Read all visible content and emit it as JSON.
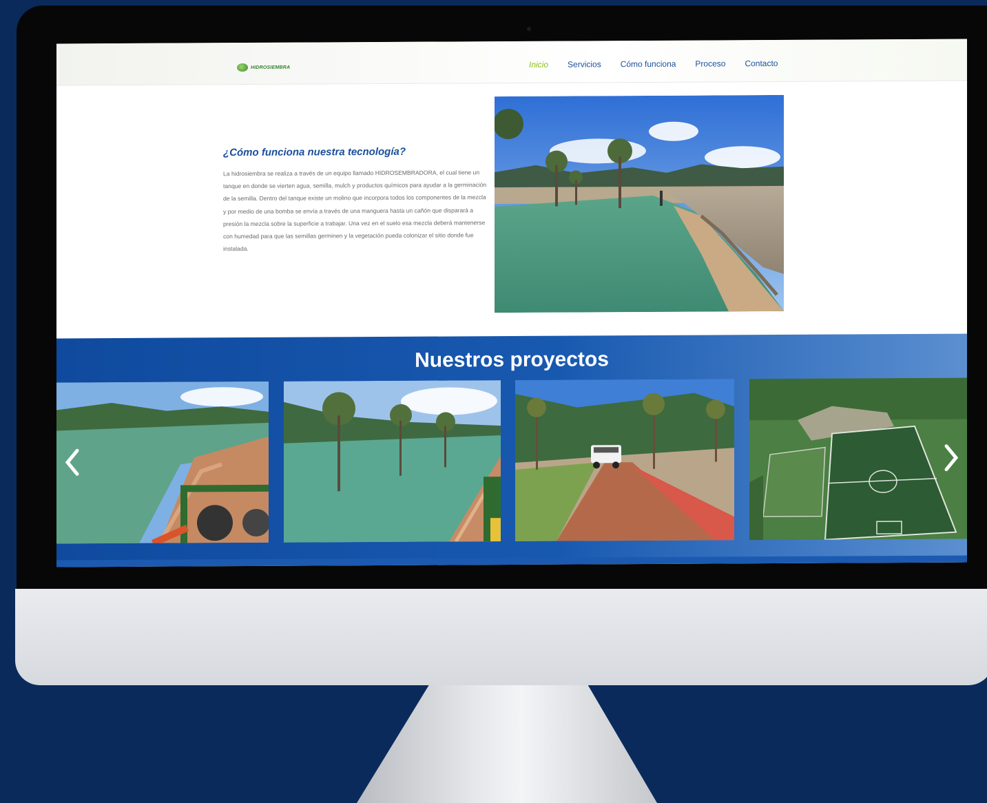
{
  "nav": {
    "logo_text": "HIDROSIEMBRA",
    "items": [
      {
        "label": "Inicio",
        "active": true
      },
      {
        "label": "Servicios",
        "active": false
      },
      {
        "label": "Cómo funciona",
        "active": false
      },
      {
        "label": "Proceso",
        "active": false
      },
      {
        "label": "Contacto",
        "active": false
      }
    ]
  },
  "info": {
    "title": "¿Cómo funciona nuestra tecnología?",
    "paragraph": "La hidrosiembra se realiza a través de un equipo llamado HIDROSEMBRADORA, el cual tiene un tanque en donde se vierten agua, semilla, mulch y productos químicos para ayudar a la germinación de la semilla. Dentro del tanque existe un molino que incorpora todos los componentes de la mezcla y por medio de una bomba se envía a través de una manguera hasta un cañón que disparará a presión la mezcla sobre la superficie a trabajar. Una vez en el suelo esa mezcla deberá mantenerse con humedad para que las semillas germinen y la vegetación pueda colonizar el sitio donde fue instalada."
  },
  "projects": {
    "title": "Nuestros proyectos",
    "prev_icon": "chevron-left-icon",
    "next_icon": "chevron-right-icon"
  },
  "colors": {
    "page_background": "#0b2a5c",
    "nav_link": "#1d4f9a",
    "nav_active": "#8cbf1e",
    "section_blue": "#1859b0"
  }
}
